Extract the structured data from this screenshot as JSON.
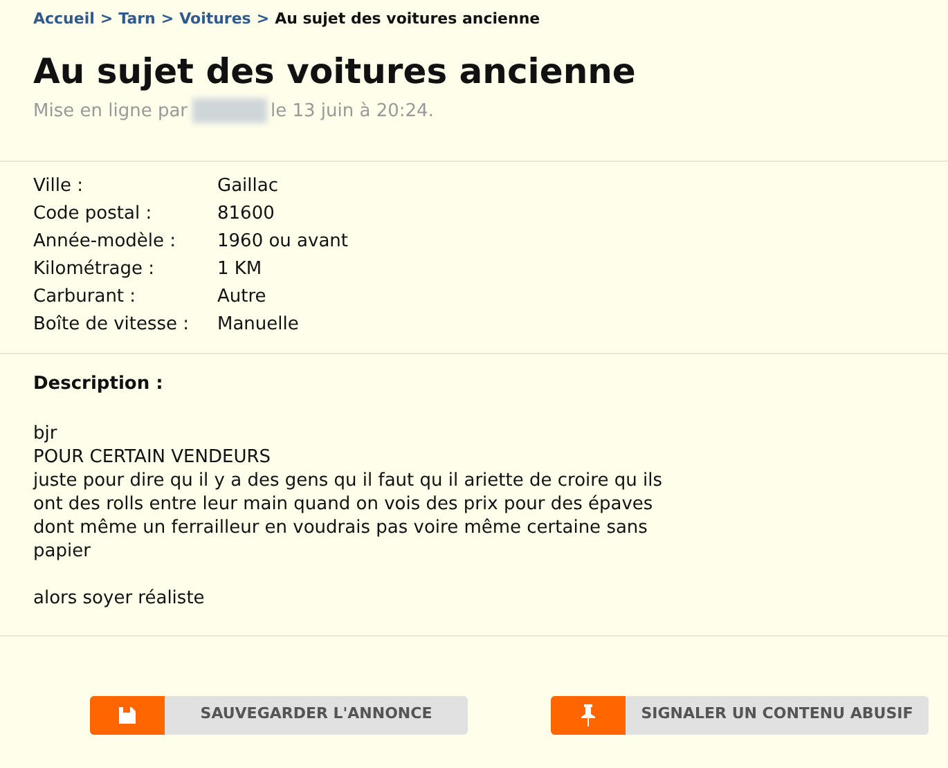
{
  "breadcrumb": {
    "links": [
      "Accueil",
      "Tarn",
      "Voitures"
    ],
    "separator": ">",
    "current": "Au sujet des voitures ancienne"
  },
  "title": "Au sujet des voitures ancienne",
  "byline": {
    "before": "Mise en ligne par",
    "after": "le 13 juin à 20:24."
  },
  "details": [
    {
      "label": "Ville :",
      "value": "Gaillac"
    },
    {
      "label": "Code postal :",
      "value": "81600"
    },
    {
      "label": "Année-modèle :",
      "value": "1960 ou avant"
    },
    {
      "label": "Kilométrage :",
      "value": "1 KM"
    },
    {
      "label": "Carburant :",
      "value": "Autre"
    },
    {
      "label": "Boîte de vitesse :",
      "value": "Manuelle"
    }
  ],
  "description": {
    "heading": "Description :",
    "paragraphs": [
      [
        "bjr",
        "POUR CERTAIN VENDEURS",
        "juste pour dire qu il y a des gens qu il faut qu il ariette de croire qu ils",
        "ont des rolls entre leur main quand on vois des prix pour des épaves",
        "dont même un ferrailleur en voudrais pas voire même certaine sans",
        "papier"
      ],
      [
        "alors soyer réaliste"
      ]
    ]
  },
  "buttons": [
    {
      "kind": "save",
      "label": "SAUVEGARDER L'ANNONCE"
    },
    {
      "kind": "report",
      "label": "SIGNALER UN CONTENU ABUSIF"
    }
  ]
}
